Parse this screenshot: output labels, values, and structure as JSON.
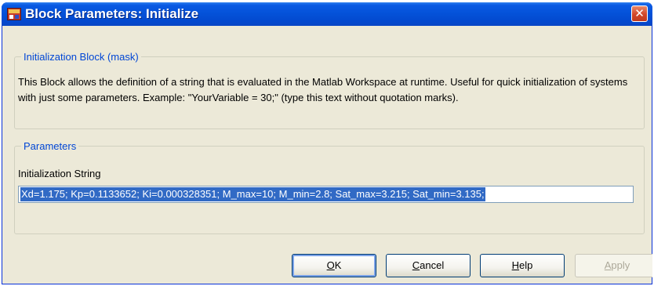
{
  "window": {
    "title": "Block Parameters: Initialize"
  },
  "mask_group": {
    "legend": "Initialization Block (mask)",
    "description": "This Block allows the definition of a string that is evaluated in the Matlab Workspace at runtime. Useful for quick initialization of systems with just some parameters. Example: \"YourVariable = 30;\" (type this text without quotation marks)."
  },
  "params_group": {
    "legend": "Parameters",
    "field_label": "Initialization String",
    "field_value": "Xd=1.175; Kp=0.1133652; Ki=0.000328351; M_max=10; M_min=2.8; Sat_max=3.215; Sat_min=3.135;"
  },
  "buttons": {
    "ok": {
      "mnemonic": "O",
      "rest": "K"
    },
    "cancel": {
      "mnemonic": "C",
      "rest": "ancel"
    },
    "help": {
      "mnemonic": "H",
      "rest": "elp"
    },
    "apply": {
      "mnemonic": "A",
      "rest": "pply"
    }
  },
  "icons": {
    "app": "simulink-block-icon",
    "close": "close-icon"
  },
  "colors": {
    "titlebar": "#0451d8",
    "close_button": "#d1462a",
    "group_legend": "#0046d5",
    "selection": "#316ac5",
    "dialog_background": "#ece9d8"
  }
}
